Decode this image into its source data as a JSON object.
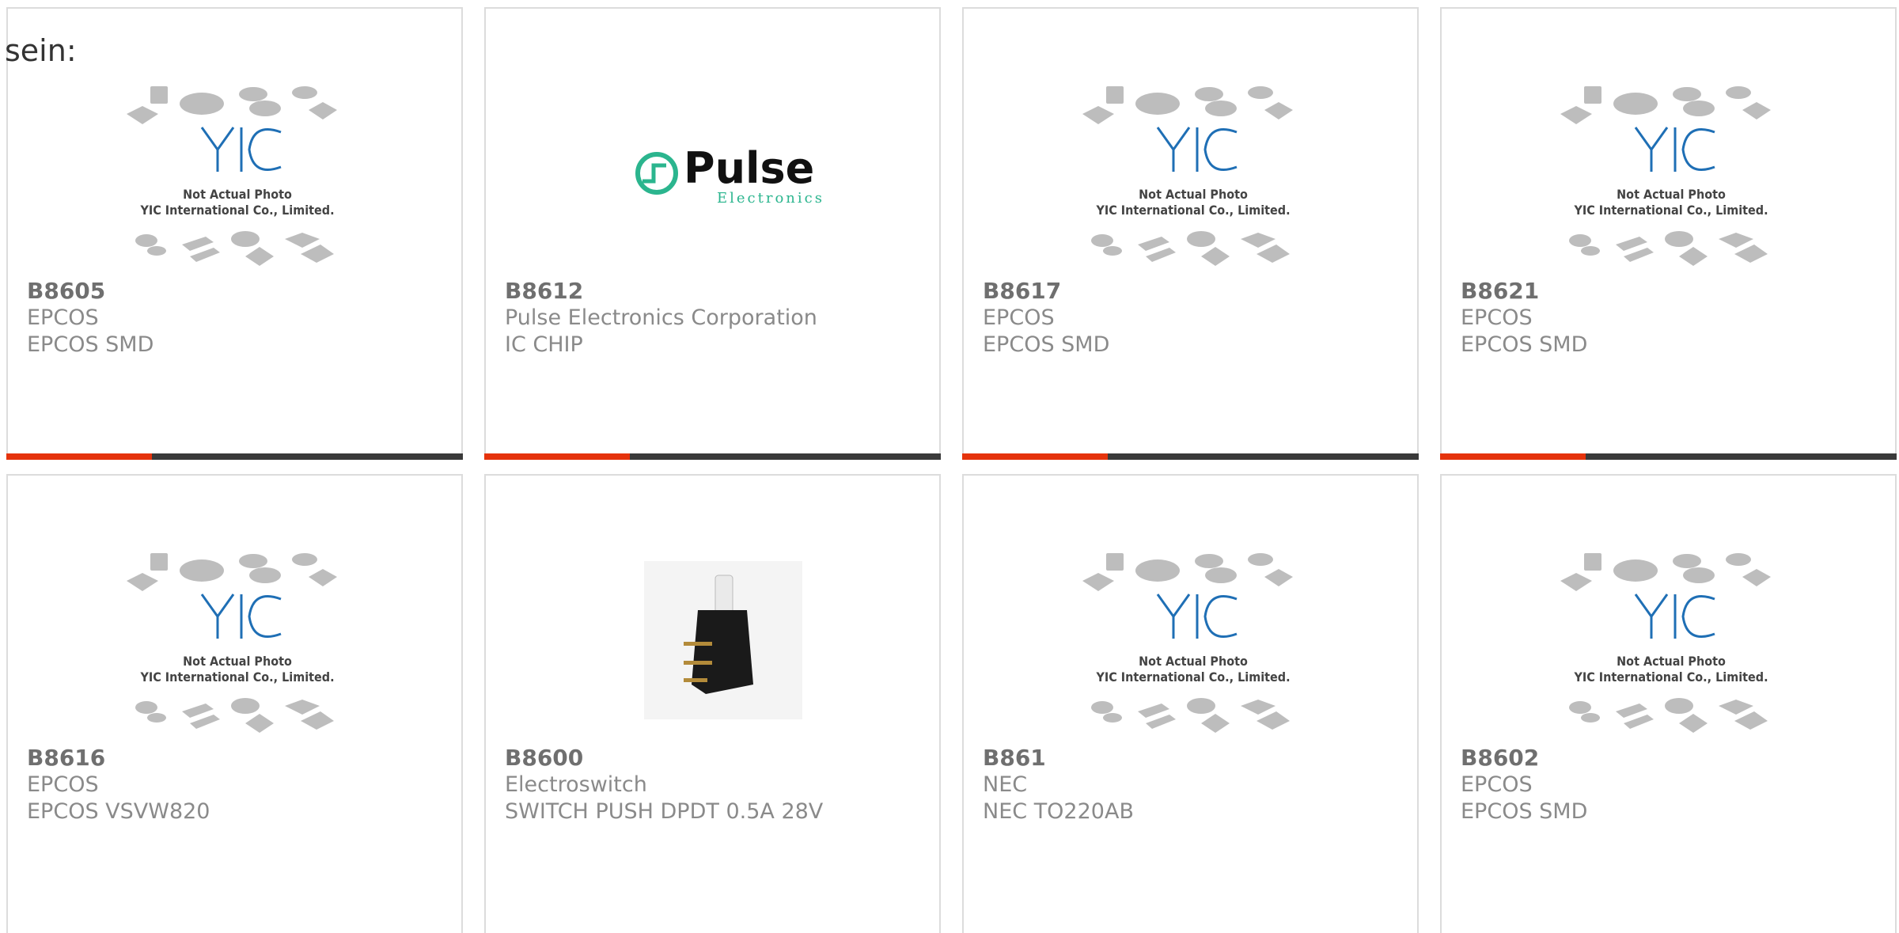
{
  "intro_text": "sein:",
  "placeholder": {
    "line1": "Not Actual Photo",
    "line2": "YIC International Co., Limited."
  },
  "pulse_logo": {
    "name": "Pulse",
    "sub": "Electronics"
  },
  "cards": [
    {
      "part": "B8605",
      "manufacturer": "EPCOS",
      "description": "EPCOS SMD"
    },
    {
      "part": "B8612",
      "manufacturer": "Pulse Electronics Corporation",
      "description": "IC CHIP"
    },
    {
      "part": "B8617",
      "manufacturer": "EPCOS",
      "description": "EPCOS SMD"
    },
    {
      "part": "B8621",
      "manufacturer": "EPCOS",
      "description": "EPCOS SMD"
    },
    {
      "part": "B8616",
      "manufacturer": "EPCOS",
      "description": "EPCOS VSVW820"
    },
    {
      "part": "B8600",
      "manufacturer": "Electroswitch",
      "description": "SWITCH PUSH DPDT 0.5A 28V"
    },
    {
      "part": "B861",
      "manufacturer": "NEC",
      "description": "NEC TO220AB"
    },
    {
      "part": "B8602",
      "manufacturer": "EPCOS",
      "description": "EPCOS SMD"
    }
  ],
  "colors": {
    "accent": "#e5330c",
    "bar": "#3a3a3a",
    "yic_blue": "#1f6fb5",
    "pulse_green": "#2bb58e"
  }
}
